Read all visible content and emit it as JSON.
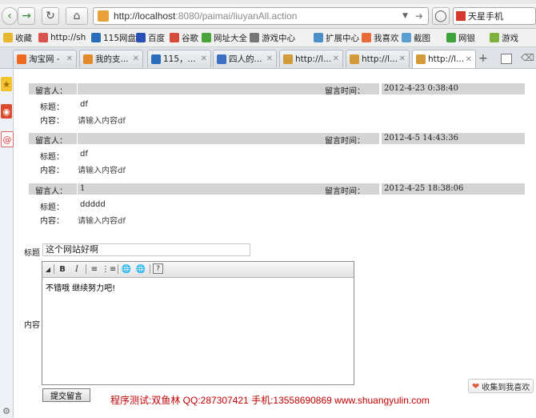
{
  "browser": {
    "url_host": "http://localhost",
    "url_rest": ":8080/paimai/liuyanAll.action",
    "search_label": "天星手机",
    "favorites": [
      {
        "label": "收藏",
        "color": "#e8b730"
      },
      {
        "label": "http://sh",
        "color": "#d9534f"
      },
      {
        "label": "115网盘",
        "color": "#2a6ebb"
      },
      {
        "label": "百度",
        "color": "#2b4fb8"
      },
      {
        "label": "谷歌",
        "color": "#d64a3b"
      },
      {
        "label": "网址大全",
        "color": "#4aa43a"
      },
      {
        "label": "游戏中心",
        "color": "#777777"
      },
      {
        "label": "扩展中心",
        "color": "#4c8fc9"
      },
      {
        "label": "我喜欢",
        "color": "#e96b3a"
      },
      {
        "label": "截图",
        "color": "#5ba0d0"
      },
      {
        "label": "网银",
        "color": "#3da33d"
      },
      {
        "label": "游戏",
        "color": "#7fb23c"
      }
    ],
    "tabs": [
      {
        "label": "淘宝网 -",
        "color": "#ee6a1f"
      },
      {
        "label": "我的支...",
        "color": "#e38b2b"
      },
      {
        "label": "115，...",
        "color": "#2a6ebb"
      },
      {
        "label": "四人的...",
        "color": "#3a6fc4"
      },
      {
        "label": "http://l...",
        "color": "#d49a3a"
      },
      {
        "label": "http://l...",
        "color": "#d49a3a"
      },
      {
        "label": "http://l...",
        "color": "#d49a3a"
      }
    ]
  },
  "messages_header": {
    "author_label": "留言人：",
    "time_label": "留言时间：",
    "title_label": "标题：",
    "content_label": "内容："
  },
  "messages": [
    {
      "author": "",
      "time": "2012-4-23 0:38:40",
      "title": "df",
      "content": "请输入内容df"
    },
    {
      "author": "",
      "time": "2012-4-5 14:43:36",
      "title": "df",
      "content": "请输入内容df"
    },
    {
      "author": "1",
      "time": "2012-4-25 18:38:06",
      "title": "ddddd",
      "content": "请输入内容df"
    }
  ],
  "form": {
    "title_label": "标题",
    "title_value": "这个网站好啊",
    "content_label": "内容",
    "editor_text": "不错哦 继续努力吧!",
    "submit_label": "提交留言"
  },
  "footer_text": "程序测试:双鱼林 QQ:287307421 手机:13558690869 www.shuangyulin.com",
  "collect_label": "收集到我喜欢"
}
